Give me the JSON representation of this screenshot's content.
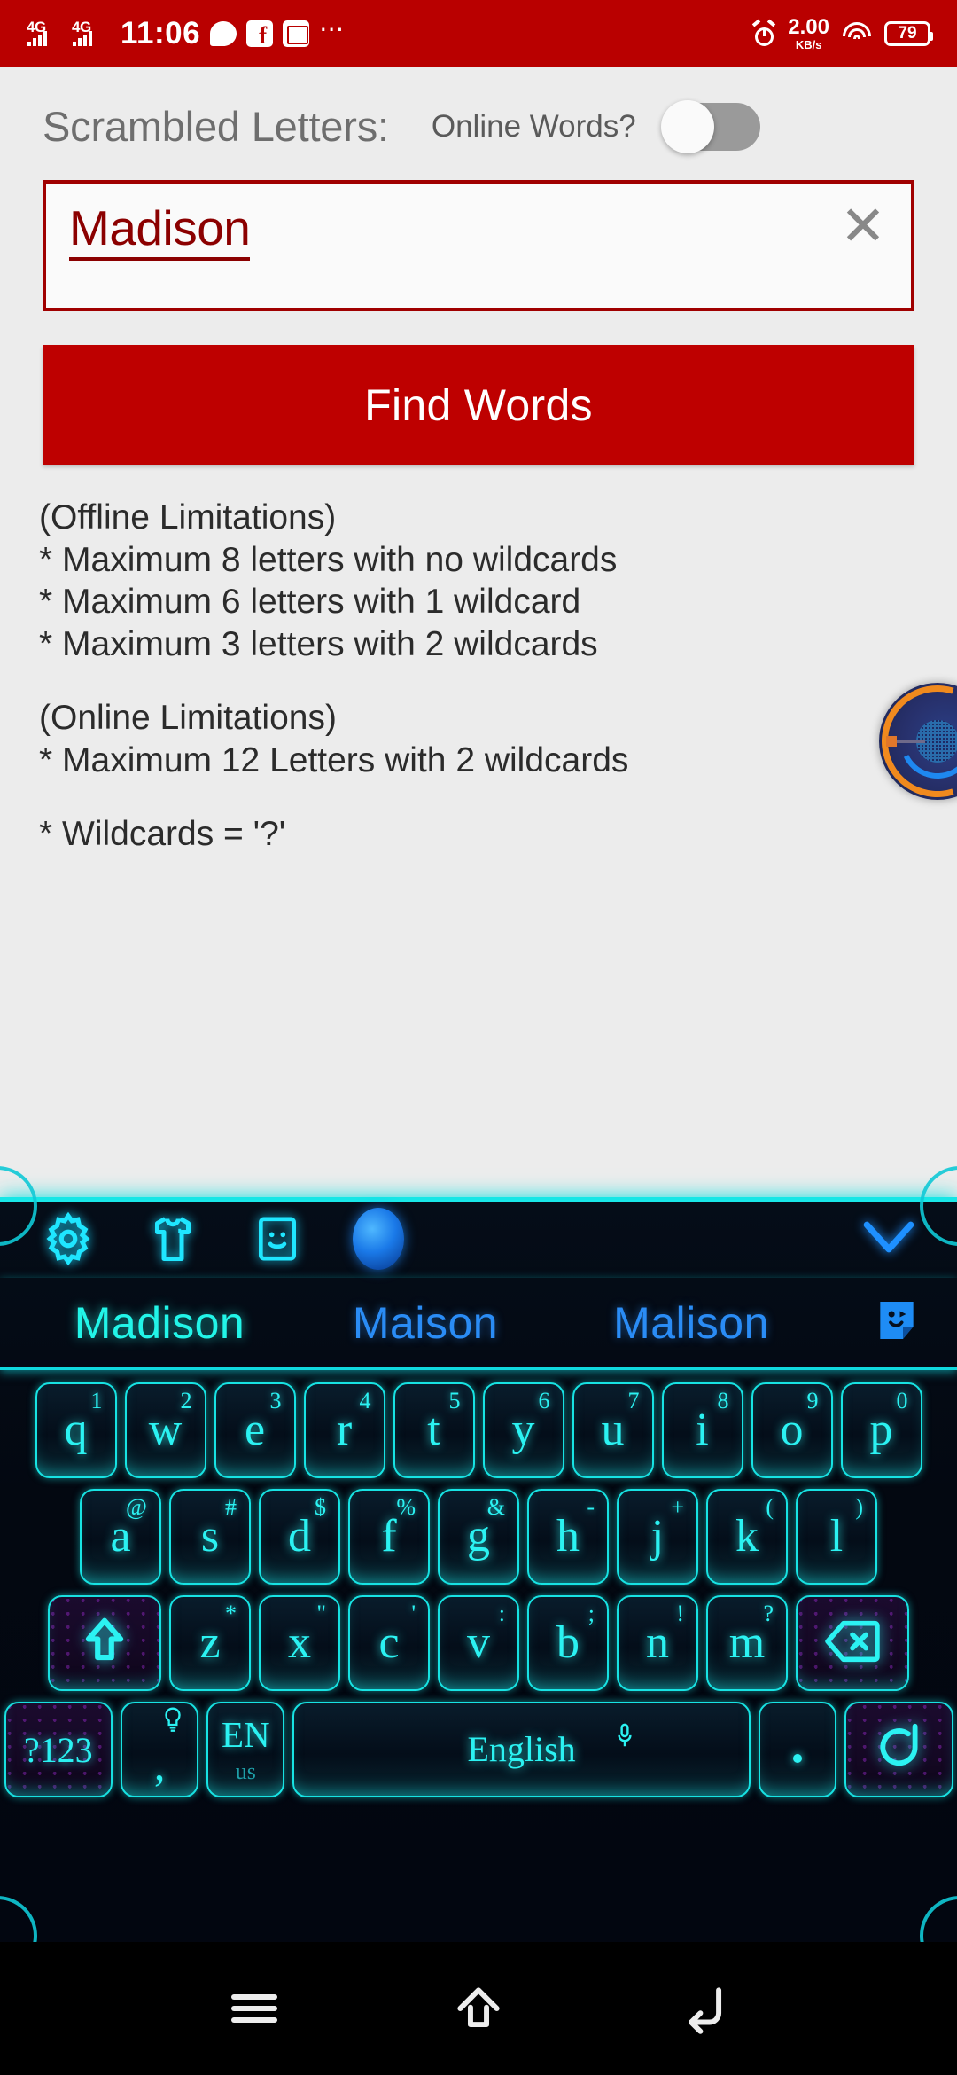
{
  "status_bar": {
    "network_1": "4G",
    "network_2": "4G",
    "time": "11:06",
    "icons": [
      "message-icon",
      "facebook-icon",
      "gallery-icon",
      "overflow-dots-icon",
      "alarm-icon"
    ],
    "data_rate_value": "2.00",
    "data_rate_unit": "KB/s",
    "battery_percent": "79",
    "background_color": "#B90000"
  },
  "app": {
    "scrambled_label": "Scrambled Letters:",
    "online_label": "Online Words?",
    "online_toggle_state": "off",
    "input": {
      "value": "Madison",
      "placeholder": "Scrambled Letters",
      "clear_glyph": "✕"
    },
    "find_button_label": "Find Words",
    "notes": {
      "offline_heading": "(Offline Limitations)",
      "offline_line_1": "* Maximum 8 letters with no wildcards",
      "offline_line_2": "* Maximum 6 letters with 1 wildcard",
      "offline_line_3": "* Maximum 3 letters with 2 wildcards",
      "online_heading": "(Online Limitations)",
      "online_line_1": "* Maximum 12 Letters with 2 wildcards",
      "wildcard_line": "* Wildcards = '?'"
    },
    "accent_color": "#BE0000",
    "input_text_color": "#8B0000",
    "background_color": "#ECECEC"
  },
  "floating_widget": {
    "name": "hud-orb-overlay"
  },
  "keyboard": {
    "toolbar": {
      "settings": "gear-icon",
      "theme": "tshirt-icon",
      "sticker": "emoji-face-icon",
      "assistant": "blue-orb-icon",
      "collapse": "chevron-down-icon"
    },
    "suggestions": [
      "Madison",
      "Maison",
      "Malison"
    ],
    "suggestion_sticker": "sticker-icon",
    "rows": [
      [
        {
          "main": "q",
          "sup": "1"
        },
        {
          "main": "w",
          "sup": "2"
        },
        {
          "main": "e",
          "sup": "3"
        },
        {
          "main": "r",
          "sup": "4"
        },
        {
          "main": "t",
          "sup": "5"
        },
        {
          "main": "y",
          "sup": "6"
        },
        {
          "main": "u",
          "sup": "7"
        },
        {
          "main": "i",
          "sup": "8"
        },
        {
          "main": "o",
          "sup": "9"
        },
        {
          "main": "p",
          "sup": "0"
        }
      ],
      [
        {
          "main": "a",
          "sup": "@"
        },
        {
          "main": "s",
          "sup": "#"
        },
        {
          "main": "d",
          "sup": "$"
        },
        {
          "main": "f",
          "sup": "%"
        },
        {
          "main": "g",
          "sup": "&"
        },
        {
          "main": "h",
          "sup": "-"
        },
        {
          "main": "j",
          "sup": "+"
        },
        {
          "main": "k",
          "sup": "("
        },
        {
          "main": "l",
          "sup": ")"
        }
      ],
      [
        {
          "main": "z",
          "sup": "*"
        },
        {
          "main": "x",
          "sup": "\""
        },
        {
          "main": "c",
          "sup": "'"
        },
        {
          "main": "v",
          "sup": ":"
        },
        {
          "main": "b",
          "sup": ";"
        },
        {
          "main": "n",
          "sup": "!"
        },
        {
          "main": "m",
          "sup": "?"
        }
      ]
    ],
    "shift_key": "shift-icon",
    "backspace_key": "backspace-icon",
    "symbols_key": "?123",
    "comma_key": ",",
    "comma_sup": "lightbulb-icon",
    "language_key": {
      "primary": "EN",
      "secondary": "us"
    },
    "space_key": "English",
    "space_mic": "microphone-icon",
    "period_key": ".",
    "enter_key": "enter-icon",
    "accent_color": "#2BF2F2",
    "active_suggestion_color": "#22F5E8",
    "suggestion_color": "#2A8CF5"
  },
  "nav_bar": {
    "recents": "recents-icon",
    "home": "home-icon",
    "back": "back-icon"
  }
}
